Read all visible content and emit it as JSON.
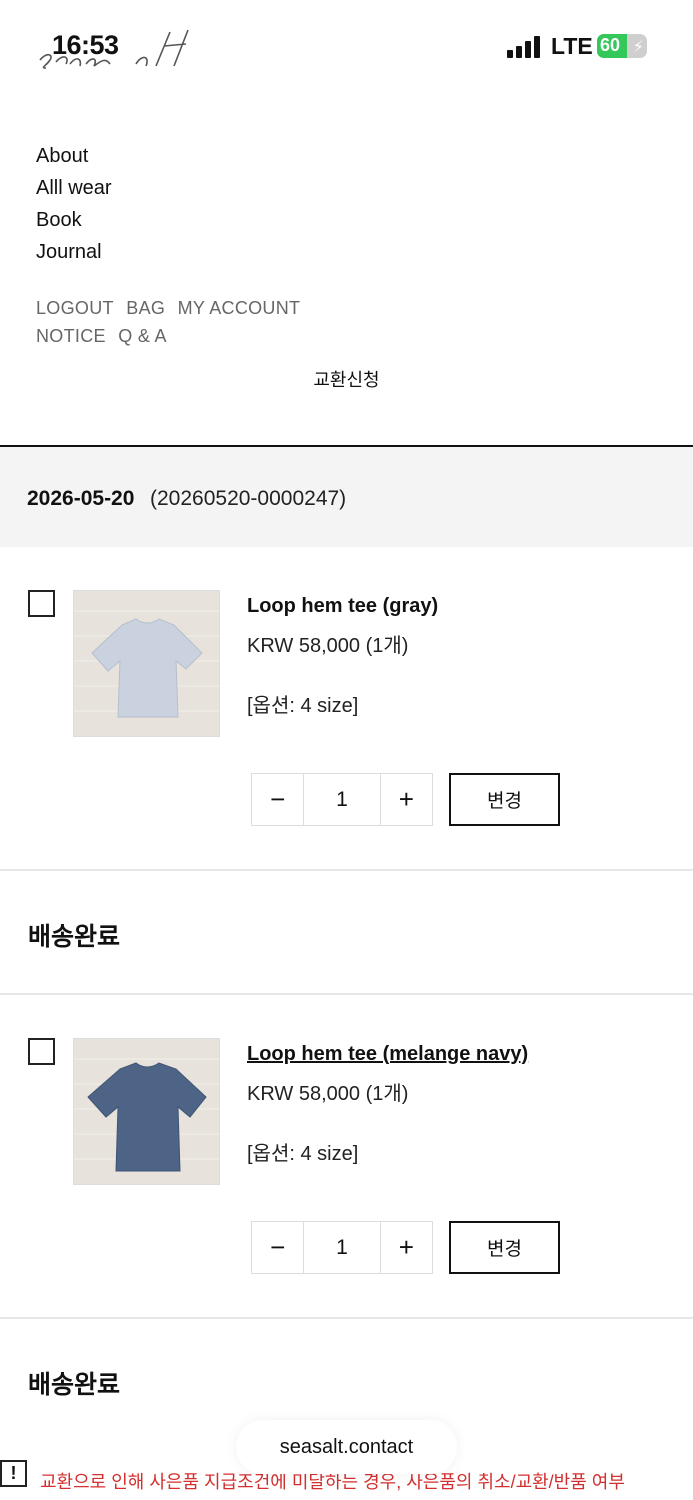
{
  "status_bar": {
    "time": "16:53",
    "network": "LTE",
    "battery_percent": 60,
    "battery_label": "60"
  },
  "brand": {
    "logo_text": "seasalt"
  },
  "nav": {
    "items": [
      "About",
      "Alll wear",
      "Book",
      "Journal"
    ]
  },
  "util_links": {
    "row1": [
      "LOGOUT",
      "BAG",
      "MY ACCOUNT"
    ],
    "row2": [
      "NOTICE",
      "Q & A"
    ]
  },
  "page_title": "교환신청",
  "order": {
    "date": "2026-05-20",
    "number": "(20260520-0000247)"
  },
  "items": [
    {
      "name": "Loop hem tee (gray)",
      "price": "KRW 58,000 (1개)",
      "option": "[옵션: 4 size]",
      "quantity": "1",
      "minus_label": "−",
      "plus_label": "+",
      "change_label": "변경",
      "status": "배송완료",
      "color": "#c9d2de"
    },
    {
      "name": "Loop hem tee (melange navy)",
      "price": "KRW 58,000 (1개)",
      "option": "[옵션: 4 size]",
      "quantity": "1",
      "minus_label": "−",
      "plus_label": "+",
      "change_label": "변경",
      "status": "배송완료",
      "color": "#4d6486"
    }
  ],
  "browser": {
    "url": "seasalt.contact"
  },
  "notice": {
    "icon_label": "!",
    "text": "교환으로 인해 사은품 지급조건에 미달하는 경우, 사은품의 취소/교환/반품 여부"
  }
}
